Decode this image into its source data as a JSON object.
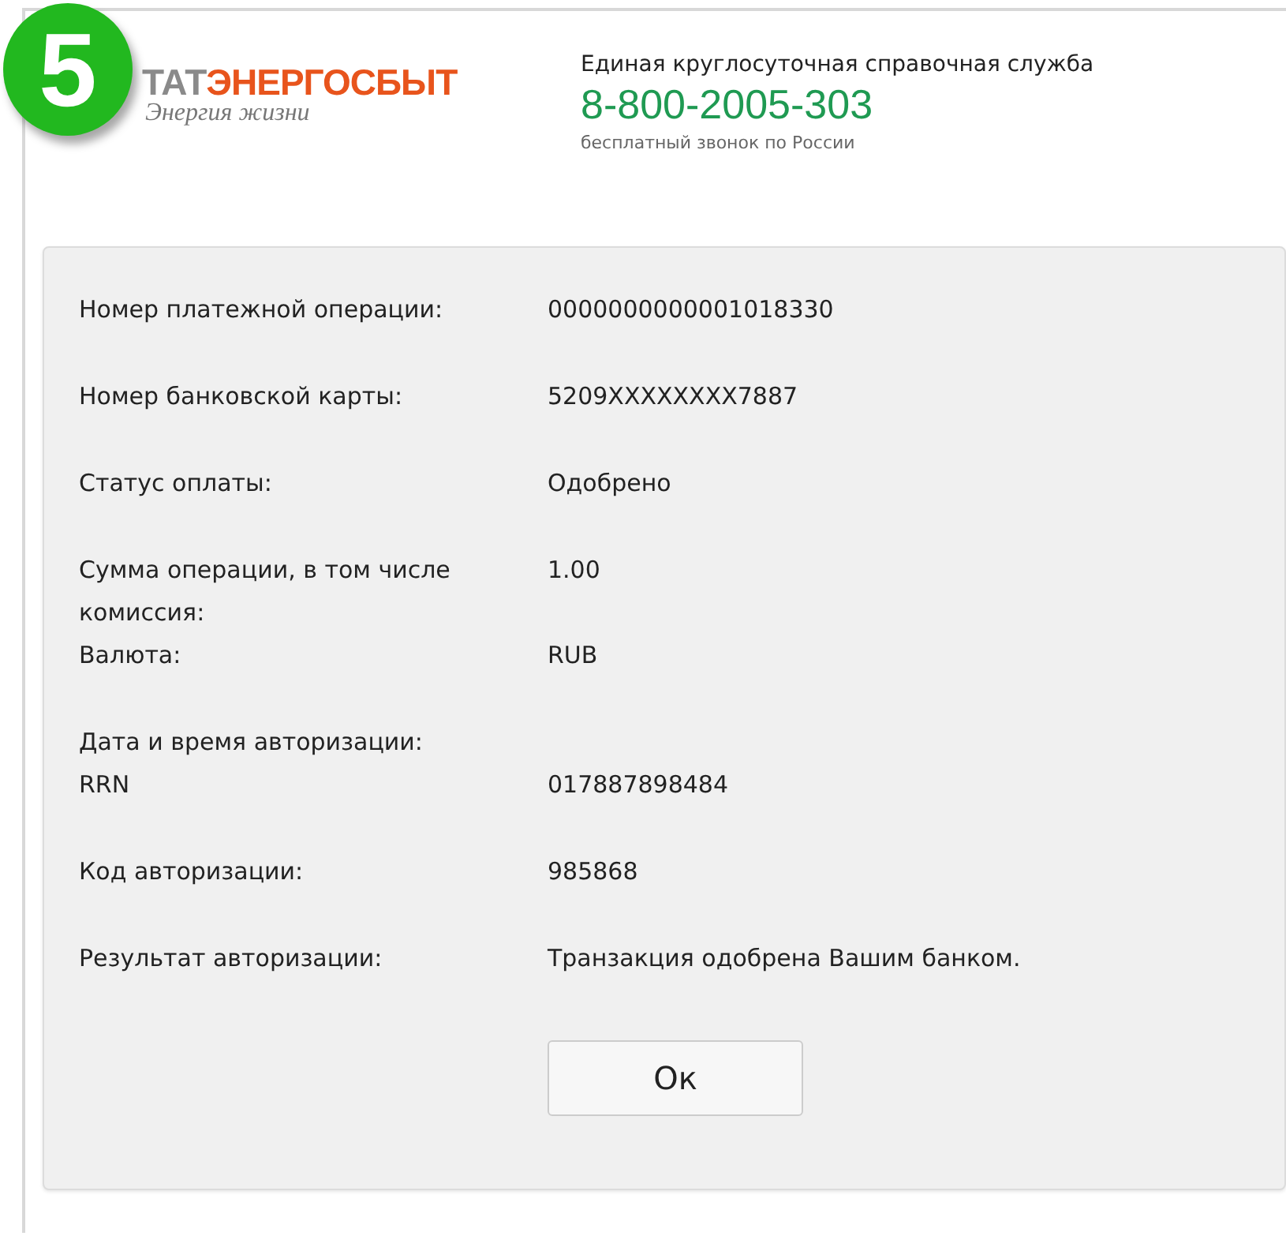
{
  "step_badge": "5",
  "logo": {
    "prefix": "ТАТ",
    "name": "ЭНЕРГОСБЫТ",
    "tagline": "Энергия жизни"
  },
  "hotline": {
    "title": "Единая круглосуточная справочная служба",
    "phone": "8-800-2005-303",
    "note": "бесплатный звонок по России"
  },
  "details": [
    [
      {
        "label": "Номер платежной операции:",
        "value": "0000000000001018330"
      }
    ],
    [
      {
        "label": "Номер банковской карты:",
        "value": "5209XXXXXXXX7887"
      }
    ],
    [
      {
        "label": "Статус оплаты:",
        "value": "Одобрено"
      }
    ],
    [
      {
        "label": "Сумма операции, в том числе комиссия:",
        "value": "1.00"
      },
      {
        "label": "Валюта:",
        "value": "RUB"
      }
    ],
    [
      {
        "label": "Дата и время авторизации:"
      },
      {
        "label": "RRN",
        "value": "017887898484"
      }
    ],
    [
      {
        "label": "Код авторизации:",
        "value": "985868"
      }
    ],
    [
      {
        "label": "Результат авторизации:",
        "value": "Транзакция одобрена Вашим банком."
      }
    ]
  ],
  "ok_button": "Ок"
}
